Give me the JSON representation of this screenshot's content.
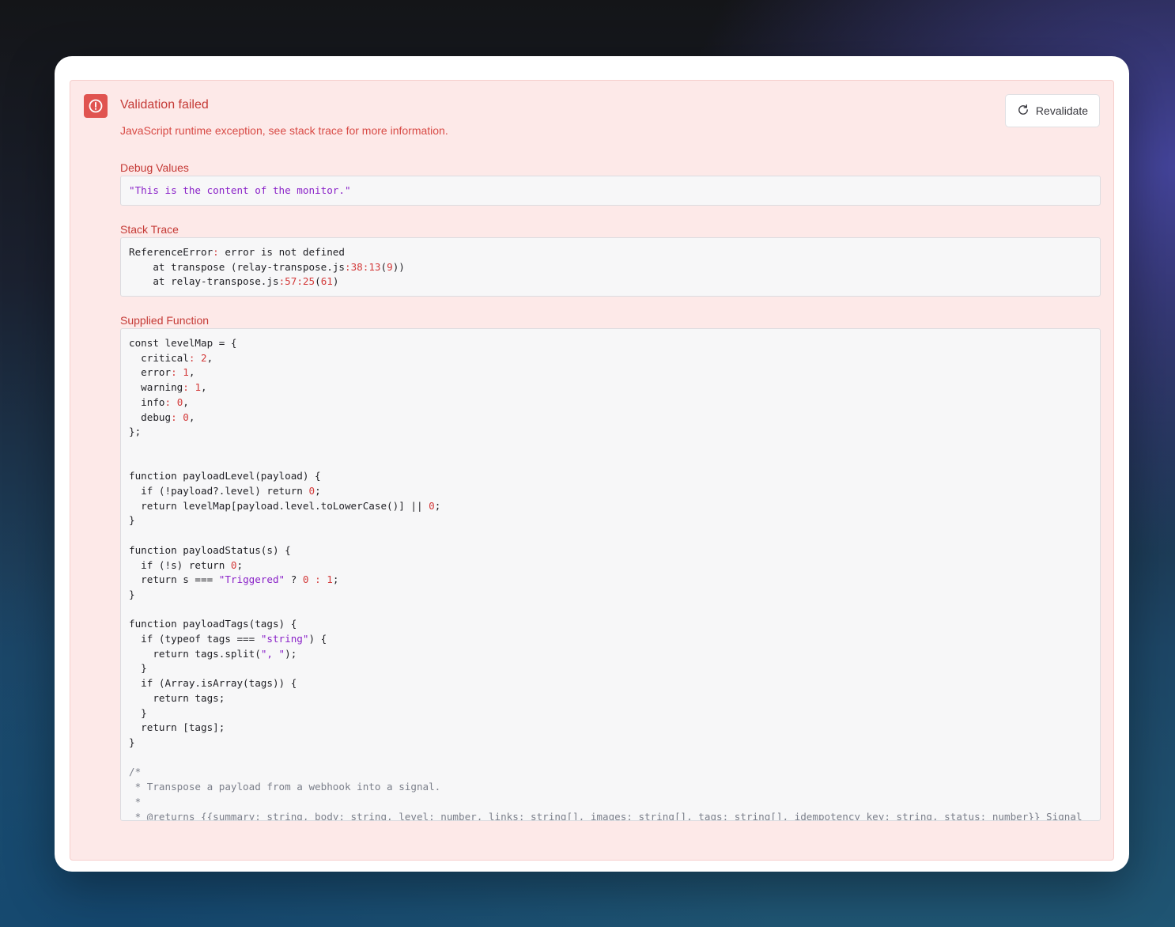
{
  "alert": {
    "title": "Validation failed",
    "subtitle": "JavaScript runtime exception, see stack trace for more information.",
    "revalidate_label": "Revalidate"
  },
  "debug_values": {
    "label": "Debug Values",
    "value": "\"This is the content of the monitor.\""
  },
  "stack_trace": {
    "label": "Stack Trace",
    "lines": [
      "ReferenceError: error is not defined",
      "    at transpose (relay-transpose.js:38:13(9))",
      "    at relay-transpose.js:57:25(61)"
    ]
  },
  "supplied_function": {
    "label": "Supplied Function",
    "lines": [
      "const levelMap = {",
      "  critical: 2,",
      "  error: 1,",
      "  warning: 1,",
      "  info: 0,",
      "  debug: 0,",
      "};",
      "",
      "",
      "function payloadLevel(payload) {",
      "  if (!payload?.level) return 0;",
      "  return levelMap[payload.level.toLowerCase()] || 0;",
      "}",
      "",
      "function payloadStatus(s) {",
      "  if (!s) return 0;",
      "  return s === \"Triggered\" ? 0 : 1;",
      "}",
      "",
      "function payloadTags(tags) {",
      "  if (typeof tags === \"string\") {",
      "    return tags.split(\", \");",
      "  }",
      "  if (Array.isArray(tags)) {",
      "    return tags;",
      "  }",
      "  return [tags];",
      "}",
      "",
      "/*",
      " * Transpose a payload from a webhook into a signal.",
      " *",
      " * @returns {{summary: string, body: string, level: number, links: string[], images: string[], tags: string[], idempotency_key: string, status: number}} Signal"
    ]
  },
  "colors": {
    "alert_bg": "#fde9e8",
    "error_text": "#c53a36",
    "icon_bg": "#e05450",
    "string": "#8a22c8",
    "number": "#d33a3a",
    "comment": "#7b7f8a"
  }
}
